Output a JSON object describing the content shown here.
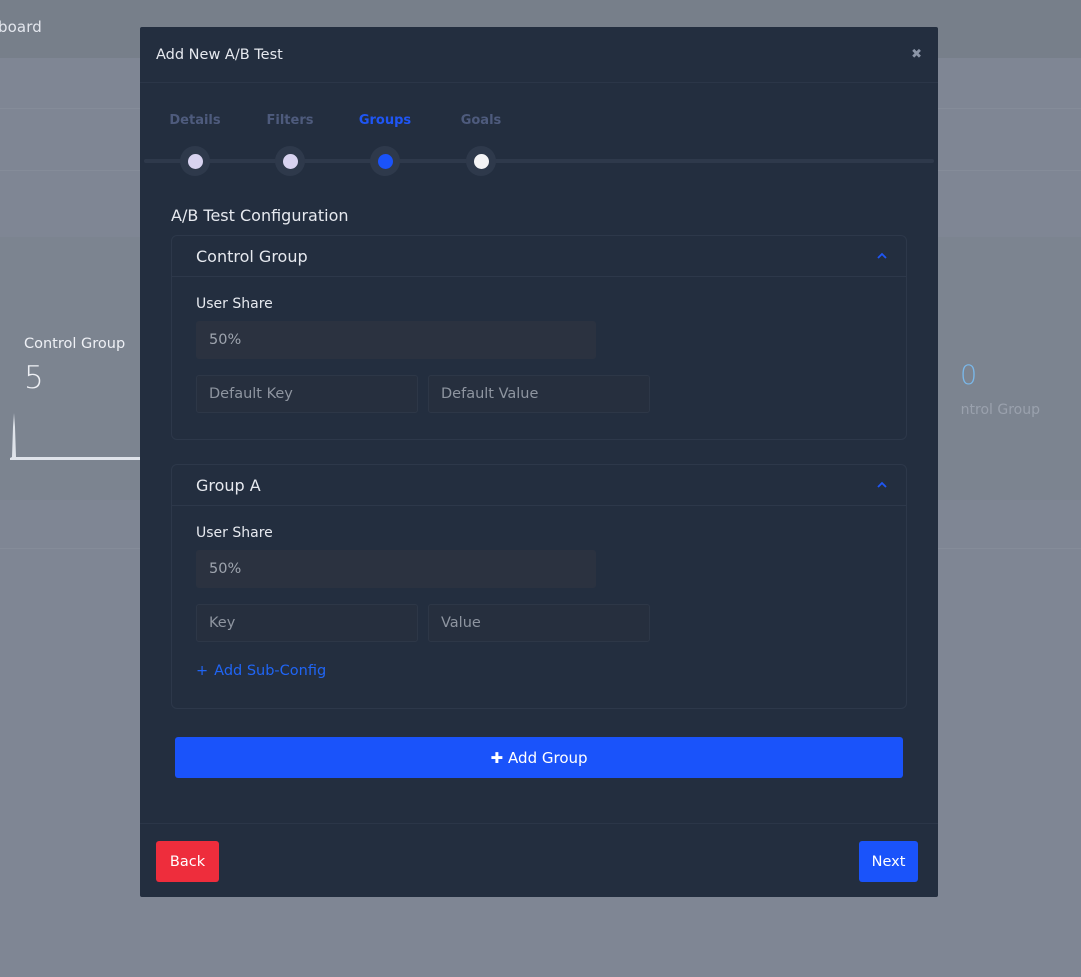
{
  "background": {
    "header_title": "board",
    "left_card": {
      "label": "Control Group",
      "value": "5"
    },
    "right_card": {
      "value": "0",
      "label": "ntrol Group"
    }
  },
  "modal": {
    "title": "Add New A/B Test",
    "close_icon": "close-icon",
    "steps": [
      {
        "label": "Details",
        "state": "done",
        "dot_color": "#d8d3f0"
      },
      {
        "label": "Filters",
        "state": "done",
        "dot_color": "#d8d3f0"
      },
      {
        "label": "Groups",
        "state": "active",
        "dot_color": "#1a53fa"
      },
      {
        "label": "Goals",
        "state": "pending",
        "dot_color": "#f4f4f6"
      }
    ],
    "section_title": "A/B Test Configuration",
    "groups": [
      {
        "title": "Control Group",
        "user_share_label": "User Share",
        "user_share_value": "50%",
        "key_placeholder": "Default Key",
        "value_placeholder": "Default Value"
      },
      {
        "title": "Group A",
        "user_share_label": "User Share",
        "user_share_value": "50%",
        "key_placeholder": "Key",
        "value_placeholder": "Value",
        "add_sub_config_label": "Add Sub-Config"
      }
    ],
    "add_group_label": "Add Group",
    "back_label": "Back",
    "next_label": "Next"
  },
  "colors": {
    "accent": "#1a53fa",
    "danger": "#ee2d3c",
    "modal_bg": "#232e3f",
    "link": "#2065f5"
  }
}
